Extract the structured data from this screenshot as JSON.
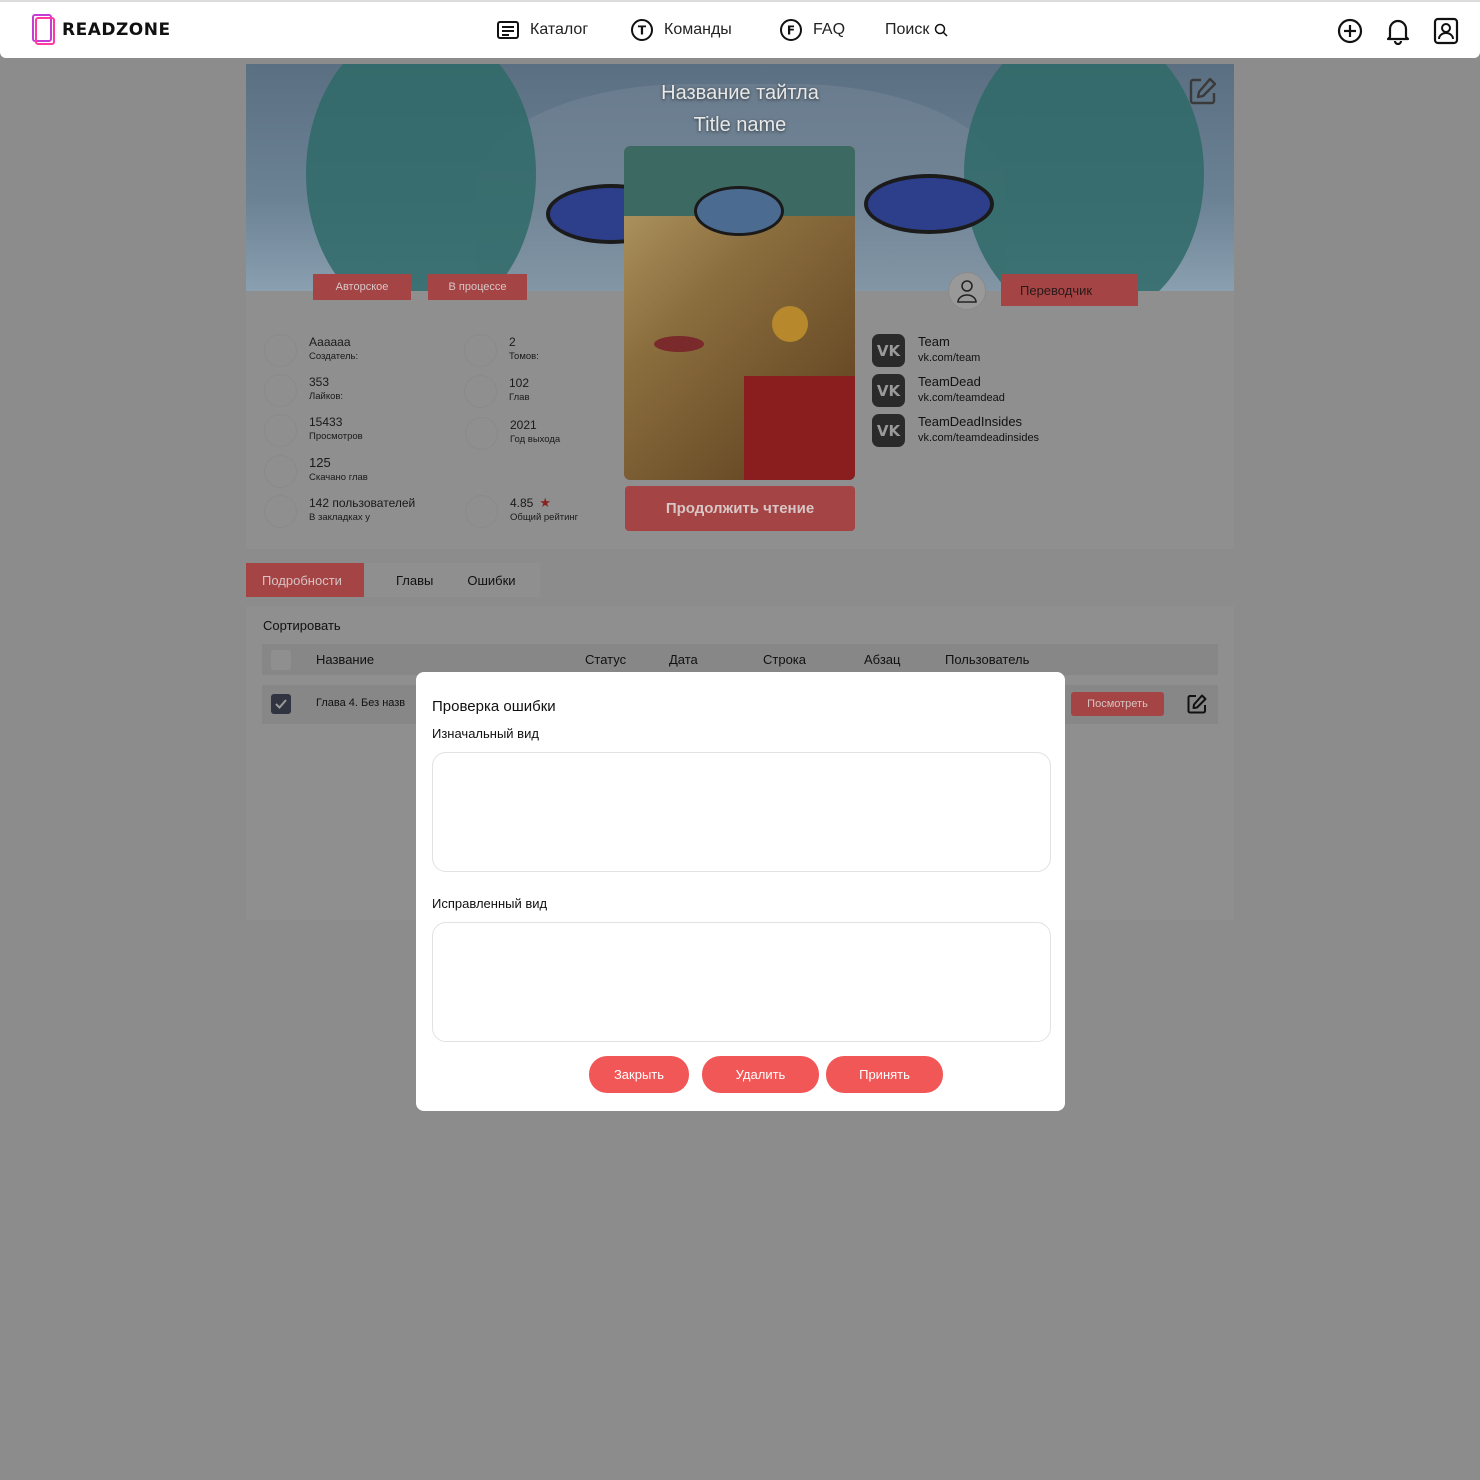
{
  "header": {
    "logo_text": "READZONE",
    "nav": [
      {
        "label": "Каталог",
        "icon": "list-icon"
      },
      {
        "label": "Команды",
        "icon": "teams-icon"
      },
      {
        "label": "FAQ",
        "icon": "faq-icon"
      },
      {
        "label": "Поиск",
        "icon": "search-icon"
      }
    ],
    "actions": [
      "add-icon",
      "bell-icon",
      "profile-icon"
    ]
  },
  "title": {
    "name_ru": "Название тайтла",
    "name_en": "Title name",
    "tags": [
      "Авторское",
      "В процессе"
    ],
    "continue_label": "Продолжить чтение"
  },
  "stats_left": [
    {
      "value": "Аааааа",
      "label": "Создатель:"
    },
    {
      "value": "353",
      "label": "Лайков:"
    },
    {
      "value": "15433",
      "label": "Просмотров"
    },
    {
      "value": "125",
      "label": "Скачано глав"
    },
    {
      "value": "142 пользователей",
      "label": "В закладках у"
    }
  ],
  "stats_right": [
    {
      "value": "2",
      "label": "Томов:"
    },
    {
      "value": "102",
      "label": "Глав"
    },
    {
      "value": "2021",
      "label": "Год выхода"
    },
    {
      "value": "4.85",
      "label": "Общий рейтинг"
    }
  ],
  "translator": {
    "label": "Переводчик",
    "teams": [
      {
        "name": "Team",
        "url": "vk.com/team"
      },
      {
        "name": "TeamDead",
        "url": "vk.com/teamdead"
      },
      {
        "name": "TeamDeadInsides",
        "url": "vk.com/teamdeadinsides"
      }
    ]
  },
  "tabs": [
    "Подробности",
    "Главы",
    "Ошибки"
  ],
  "errors": {
    "sort_label": "Сортировать",
    "columns": [
      "Название",
      "Статус",
      "Дата",
      "Строка",
      "Абзац",
      "Пользователь"
    ],
    "row": {
      "title": "Глава 4. Без назв",
      "view_label": "Посмотреть"
    }
  },
  "modal": {
    "title": "Проверка ошибки",
    "original_label": "Изначальный вид",
    "original_value": "",
    "fixed_label": "Исправленный вид",
    "fixed_value": "",
    "close_label": "Закрыть",
    "delete_label": "Удалить",
    "accept_label": "Принять"
  },
  "colors": {
    "accent": "#f25757",
    "accent_dimmed": "#a44444",
    "overlay": "#8c8c8c"
  }
}
